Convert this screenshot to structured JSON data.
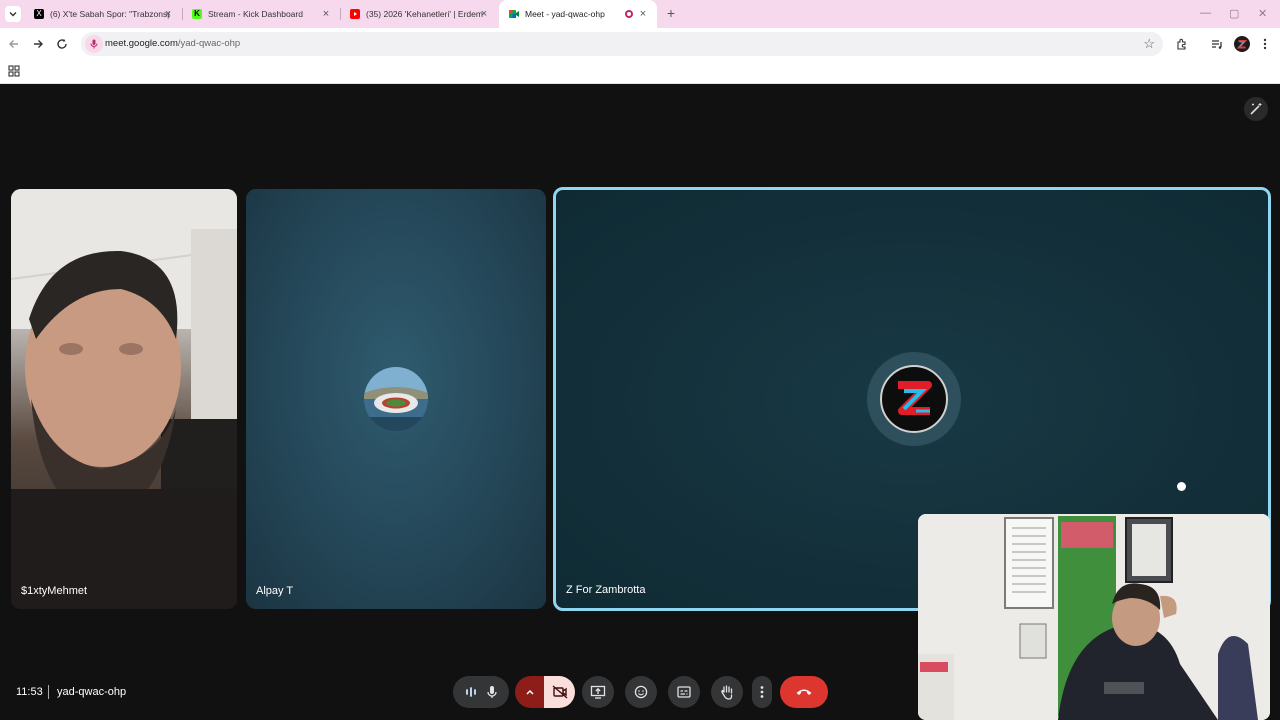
{
  "browser": {
    "tabs": [
      {
        "title": "(6) X'te Sabah Spor: \"Trabzonsp",
        "favicon": "x-logo-icon"
      },
      {
        "title": "Stream - Kick Dashboard",
        "favicon": "kick-logo-icon"
      },
      {
        "title": "(35) 2026 'Kehanetleri' | Erdem ",
        "favicon": "youtube-logo-icon"
      },
      {
        "title": "Meet - yad-qwac-ohp",
        "favicon": "meet-logo-icon",
        "active": true
      }
    ],
    "url_host": "meet.google.com",
    "url_path": "/yad-qwac-ohp"
  },
  "meet": {
    "participants": [
      {
        "name": "$1xtyMehmet"
      },
      {
        "name": "Alpay T"
      },
      {
        "name": "Z For Zambrotta",
        "active_speaker": true
      }
    ],
    "time": "11:53",
    "meeting_code": "yad-qwac-ohp",
    "controls": [
      "audio-levels-icon",
      "microphone-icon",
      "camera-options-chevron-icon",
      "camera-off-icon",
      "present-screen-icon",
      "emoji-icon",
      "captions-icon",
      "raise-hand-icon",
      "more-options-icon",
      "end-call-icon"
    ],
    "accent_color": "#8fd6f0",
    "end_call_color": "#dc362e"
  }
}
